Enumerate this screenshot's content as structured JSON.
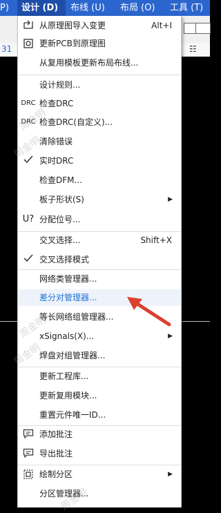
{
  "menubar": {
    "items": [
      {
        "label": "P)"
      },
      {
        "label": "设计 (D)"
      },
      {
        "label": "布线 (U)"
      },
      {
        "label": "布局 (O)"
      },
      {
        "label": "工具 (T)"
      }
    ]
  },
  "toolbar": {
    "left_number": "31"
  },
  "menu": {
    "items": [
      {
        "label": "从原理图导入变更",
        "shortcut": "Alt+I",
        "icon": "import-icon"
      },
      {
        "label": "更新PCB到原理图",
        "icon": "update-pcb-icon"
      },
      {
        "label": "从复用模板更新布局布线..."
      },
      {
        "label": "设计规则..."
      },
      {
        "label": "检查DRC",
        "icon": "drc-icon",
        "icon_text": "DRC"
      },
      {
        "label": "检查DRC(自定义)...",
        "icon": "drc-custom-icon",
        "icon_text": "DRC"
      },
      {
        "label": "清除错误"
      },
      {
        "label": "实时DRC",
        "icon": "check-icon"
      },
      {
        "label": "检查DFM..."
      },
      {
        "label": "板子形状(S)"
      },
      {
        "label": "分配位号...",
        "icon": "assign-designator-icon"
      },
      {
        "label": "交叉选择...",
        "shortcut": "Shift+X"
      },
      {
        "label": "交叉选择模式",
        "icon": "check-icon"
      },
      {
        "label": "网络类管理器..."
      },
      {
        "label": "差分对管理器..."
      },
      {
        "label": "等长网络组管理器..."
      },
      {
        "label": "xSignals(X)..."
      },
      {
        "label": "焊盘对组管理器..."
      },
      {
        "label": "更新工程库..."
      },
      {
        "label": "更新复用模块..."
      },
      {
        "label": "重置元件唯一ID..."
      },
      {
        "label": "添加批注",
        "icon": "comment-icon"
      },
      {
        "label": "导出批注",
        "icon": "export-comment-icon"
      },
      {
        "label": "绘制分区",
        "icon": "partition-icon"
      },
      {
        "label": "分区管理器..."
      }
    ]
  },
  "watermarks": [
    "周金明",
    "周金明",
    "周金明",
    "周金明",
    "周金明",
    "周金明"
  ],
  "colors": {
    "menubar": "#2b66cf",
    "highlight_text": "#1e73d6",
    "arrow": "#d9412f"
  }
}
